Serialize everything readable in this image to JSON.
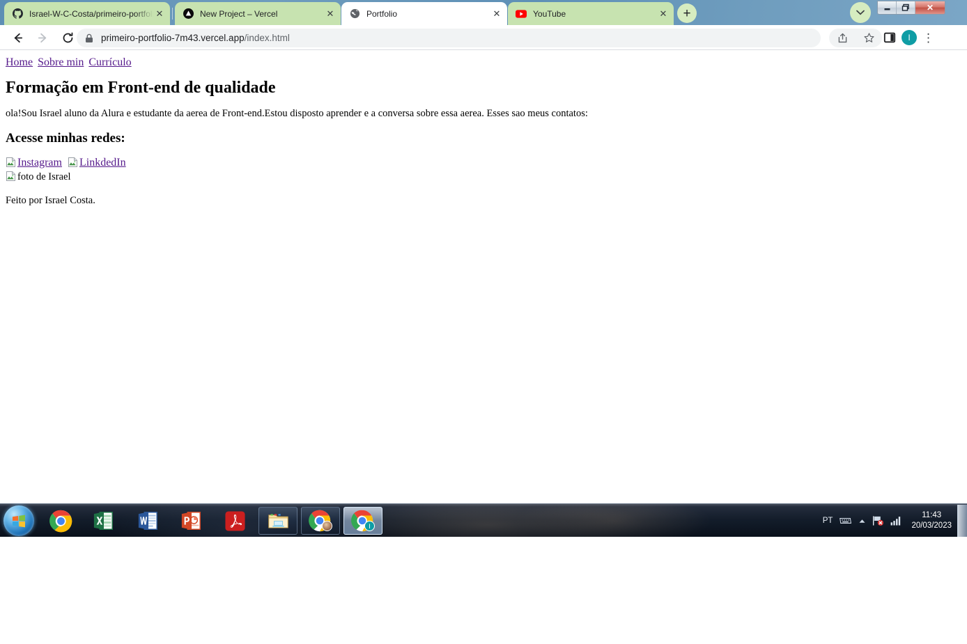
{
  "browser": {
    "tabs": [
      {
        "title": "Israel-W-C-Costa/primeiro-portfolio",
        "favicon": "github-icon",
        "active": false,
        "closable": true
      },
      {
        "title": "New Project – Vercel",
        "favicon": "vercel-icon",
        "active": false,
        "closable": true
      },
      {
        "title": "Portfolio",
        "favicon": "globe-icon",
        "active": true,
        "closable": true
      },
      {
        "title": "YouTube",
        "favicon": "youtube-icon",
        "active": false,
        "closable": true
      }
    ],
    "new_tab_label": "+",
    "tab_search_label": "⌄",
    "caption": {
      "minimize": "—",
      "maximize": "❐",
      "close": "✕"
    },
    "toolbar": {
      "back_label": "←",
      "forward_label": "→",
      "reload_label": "⟳",
      "lock_icon": "lock-icon",
      "url_domain": "primeiro-portfolio-7m43.vercel.app",
      "url_path": "/index.html",
      "share_label": "share-icon",
      "bookmark_label": "star-icon",
      "side_panel_label": "side-panel-icon",
      "profile_initial": "I",
      "menu_label": "⋮"
    }
  },
  "page": {
    "nav": [
      {
        "label": "Home"
      },
      {
        "label": "Sobre min"
      },
      {
        "label": "Currículo"
      }
    ],
    "heading": "Formação em Front-end de qualidade",
    "paragraph": "ola!Sou Israel aluno da Alura e estudante da aerea de Front-end.Estou disposto aprender e a conversa sobre essa aerea. Esses sao meus contatos:",
    "subheading": "Acesse minhas redes:",
    "broken_images": [
      {
        "alt": "Instagram",
        "is_link": true
      },
      {
        "alt": "LinkdedIn",
        "is_link": true
      },
      {
        "alt": "foto de Israel",
        "is_link": false
      }
    ],
    "footer": "Feito por Israel Costa."
  },
  "taskbar": {
    "start_label": "start-orb",
    "pinned": [
      {
        "name": "chrome-icon"
      },
      {
        "name": "excel-icon"
      },
      {
        "name": "word-icon"
      },
      {
        "name": "powerpoint-icon"
      },
      {
        "name": "acrobat-icon"
      }
    ],
    "windows": [
      {
        "name": "explorer-window",
        "active": false
      },
      {
        "name": "chrome-window-1",
        "active": false
      },
      {
        "name": "chrome-window-2",
        "active": true
      }
    ],
    "tray": {
      "language": "PT",
      "keyboard_icon": "keyboard-icon",
      "show_hidden_label": "▲",
      "network_icon": "network-error-icon",
      "volume_icon": "signal-bars-icon",
      "time": "11:43",
      "date": "20/03/2023"
    }
  }
}
